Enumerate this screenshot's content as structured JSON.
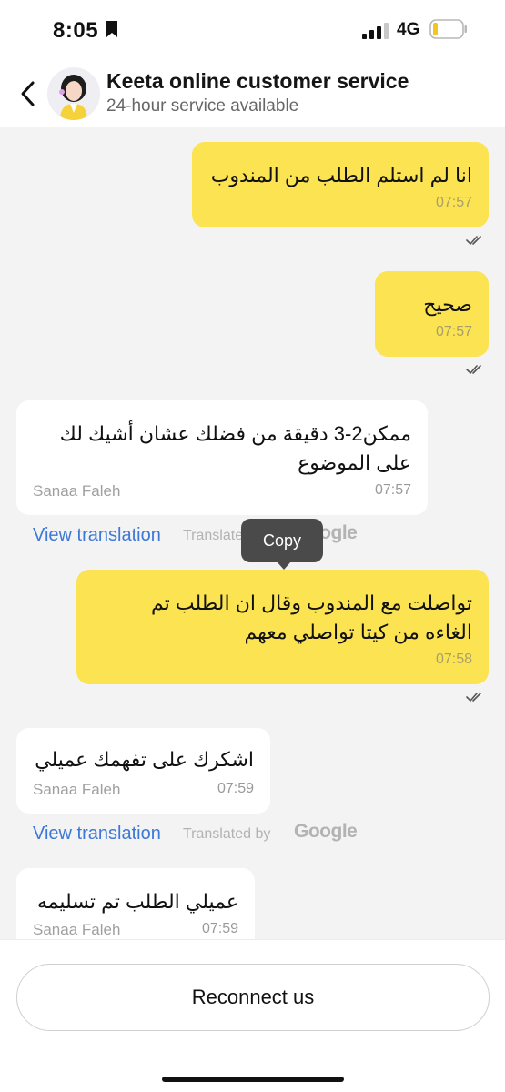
{
  "status_bar": {
    "time": "8:05",
    "network": "4G",
    "icons": [
      "bookmark-icon",
      "signal-icon",
      "battery-icon"
    ]
  },
  "header": {
    "title": "Keeta online customer service",
    "subtitle": "24-hour service available",
    "back_icon": "chevron-left-icon",
    "avatar_icon": "customer-service-avatar"
  },
  "messages": [
    {
      "side": "user",
      "lines": [
        "انا لم استلم الطلب من المندوب"
      ],
      "time": "07:57",
      "read": true
    },
    {
      "side": "user",
      "lines": [
        "صحيح"
      ],
      "time": "07:57",
      "read": true
    },
    {
      "side": "agent",
      "sender": "Sanaa Faleh",
      "lines": [
        "ممكن2-3 دقيقة من فضلك عشان أشيك لك",
        "على الموضوع"
      ],
      "time": "07:57"
    },
    {
      "side": "user",
      "lines": [
        "تواصلت مع المندوب وقال ان الطلب تم",
        "الغاءه من كيتا تواصلي معهم"
      ],
      "time": "07:58",
      "read": true
    },
    {
      "side": "agent",
      "sender": "Sanaa Faleh",
      "lines": [
        "اشكرك على تفهمك عميلي"
      ],
      "time": "07:59"
    },
    {
      "side": "agent",
      "sender": "Sanaa Faleh",
      "lines": [
        "عميلي الطلب تم تسليمه"
      ],
      "time": "07:59"
    }
  ],
  "translation": {
    "view_label": "View translation",
    "translated_by": "Translated by",
    "provider": "Google"
  },
  "tooltip": {
    "copy_label": "Copy"
  },
  "footer": {
    "reconnect_label": "Reconnect us"
  },
  "colors": {
    "user_bubble": "#fbe352",
    "agent_bubble": "#ffffff",
    "link": "#3b78d8",
    "background": "#f3f3f3"
  }
}
